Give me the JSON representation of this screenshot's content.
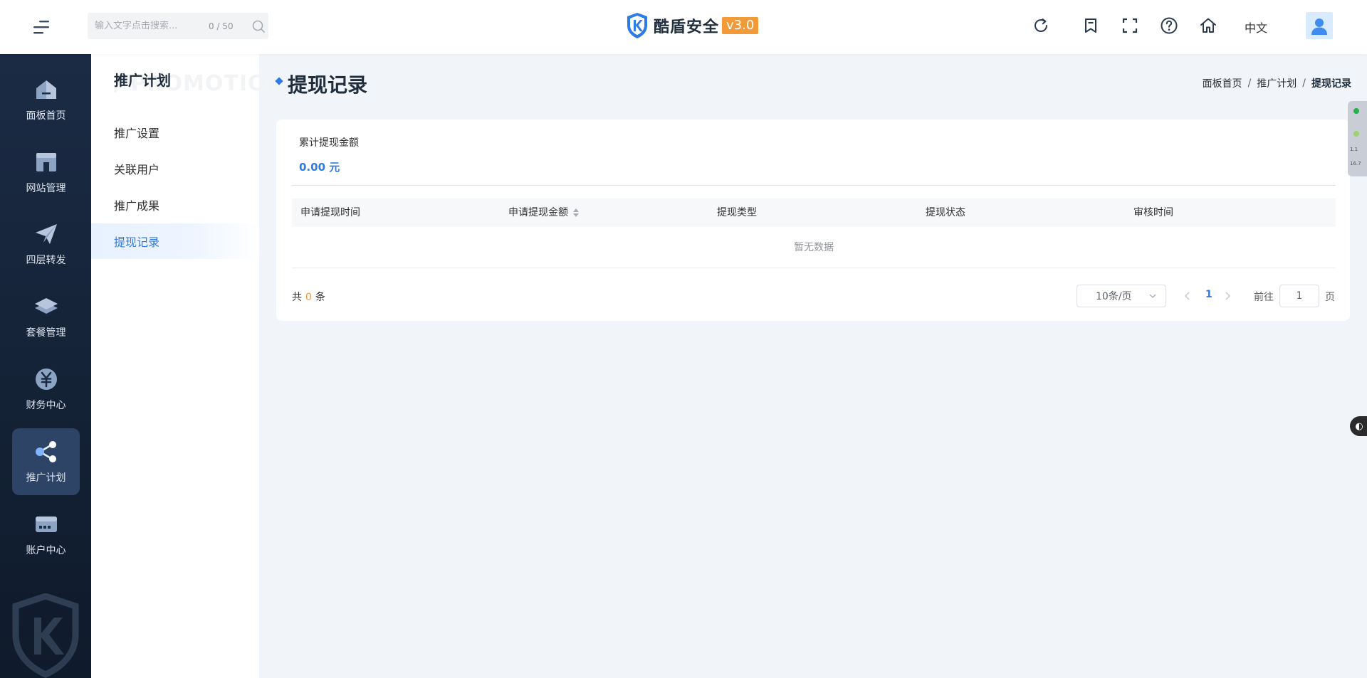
{
  "header": {
    "search_placeholder": "输入文字点击搜索...",
    "search_counter": "0 / 50",
    "brand_name": "酷盾安全",
    "brand_version": "v3.0",
    "language": "中文",
    "icons": [
      "refresh-icon",
      "bookmark-icon",
      "fullscreen-icon",
      "help-icon",
      "home-icon"
    ]
  },
  "sidebar": {
    "items": [
      {
        "label": "面板首页",
        "icon": "dashboard-icon"
      },
      {
        "label": "网站管理",
        "icon": "website-icon"
      },
      {
        "label": "四层转发",
        "icon": "send-icon"
      },
      {
        "label": "套餐管理",
        "icon": "layers-icon"
      },
      {
        "label": "财务中心",
        "icon": "yuan-icon"
      },
      {
        "label": "推广计划",
        "icon": "share-icon",
        "active": true
      },
      {
        "label": "账户中心",
        "icon": "card-icon"
      }
    ]
  },
  "submenu": {
    "title": "推广计划",
    "watermark": "/ PROMOTION",
    "items": [
      {
        "label": "推广设置"
      },
      {
        "label": "关联用户"
      },
      {
        "label": "推广成果"
      },
      {
        "label": "提现记录",
        "active": true
      }
    ]
  },
  "page": {
    "title": "提现记录",
    "breadcrumb": [
      "面板首页",
      "推广计划",
      "提现记录"
    ],
    "breadcrumb_sep": "/"
  },
  "summary": {
    "label": "累计提现金额",
    "value": "0.00 元"
  },
  "table": {
    "columns": [
      "申请提现时间",
      "申请提现金额",
      "提现类型",
      "提现状态",
      "审核时间"
    ],
    "empty_text": "暂无数据"
  },
  "pagination": {
    "total_prefix": "共",
    "total_count": "0",
    "total_suffix": "条",
    "page_size": "10条/页",
    "current_page": "1",
    "goto_label": "前往",
    "goto_value": "1",
    "goto_suffix": "页"
  },
  "edge_widget": {
    "line1": "1.1",
    "line2": "16.7"
  },
  "colors": {
    "accent": "#2f7be5",
    "version_badge": "#f29a38",
    "sidebar_bg": "#1b2b44",
    "sidebar_active": "#2e4466"
  }
}
